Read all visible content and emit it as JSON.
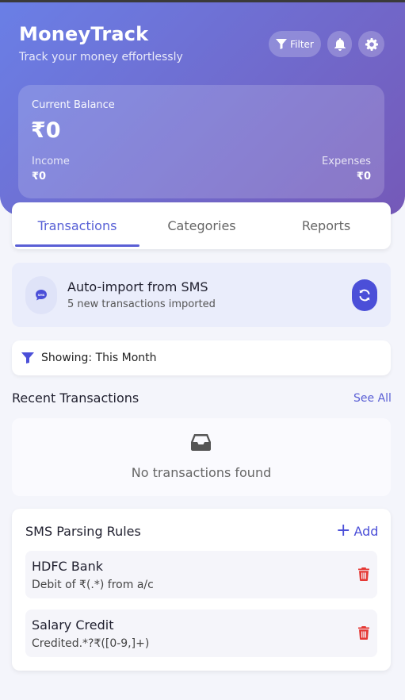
{
  "header": {
    "title": "MoneyTrack",
    "subtitle": "Track your money effortlessly",
    "filter_label": "Filter",
    "icons": [
      "filter-icon",
      "bell-icon",
      "gear-icon"
    ]
  },
  "balance": {
    "label": "Current Balance",
    "value": "₹0",
    "income_label": "Income",
    "income_value": "₹0",
    "expenses_label": "Expenses",
    "expenses_value": "₹0"
  },
  "tabs": [
    {
      "label": "Transactions",
      "active": true
    },
    {
      "label": "Categories",
      "active": false
    },
    {
      "label": "Reports",
      "active": false
    }
  ],
  "sms_import": {
    "title": "Auto-import from SMS",
    "subtitle": "5 new transactions imported",
    "icon_text": "SMS"
  },
  "filter_status": {
    "text": "Showing: This Month"
  },
  "recent": {
    "title": "Recent Transactions",
    "see_all": "See All",
    "empty_text": "No transactions found"
  },
  "rules": {
    "title": "SMS Parsing Rules",
    "add_label": "Add",
    "items": [
      {
        "name": "HDFC Bank",
        "pattern": "Debit of ₹(.*) from a/c"
      },
      {
        "name": "Salary Credit",
        "pattern": "Credited.*?₹([0-9,]+)"
      }
    ]
  },
  "colors": {
    "accent": "#5a5fd5",
    "header_gradient_start": "#6a7fe6",
    "header_gradient_end": "#7559b8",
    "danger": "#e53935"
  }
}
